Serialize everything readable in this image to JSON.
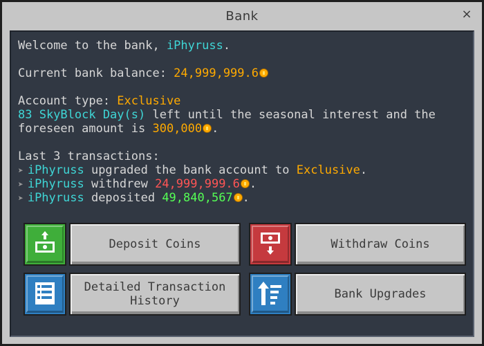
{
  "window": {
    "title": "Bank",
    "close_label": "×"
  },
  "welcome": {
    "prefix": "Welcome to the bank, ",
    "player": "iPhyruss",
    "suffix": "."
  },
  "balance": {
    "label": "Current bank balance: ",
    "value": "24,999,999.6"
  },
  "account": {
    "type_label": "Account type: ",
    "type_value": "Exclusive",
    "days": "83 SkyBlock Day(s)",
    "interest_text_1": " left until the seasonal interest and the",
    "interest_text_2": "foreseen amount is ",
    "interest_amount": "300,000",
    "interest_suffix": "."
  },
  "transactions": {
    "header": "Last 3 transactions:",
    "items": [
      {
        "player": "iPhyruss",
        "action": " upgraded the bank account to ",
        "value": "Exclusive",
        "suffix": ".",
        "coin": false
      },
      {
        "player": "iPhyruss",
        "action": " withdrew ",
        "value": "24,999,999.6",
        "suffix": ".",
        "coin": true
      },
      {
        "player": "iPhyruss",
        "action": " deposited ",
        "value": "49,840,567",
        "suffix": ".",
        "coin": true
      }
    ]
  },
  "buttons": {
    "deposit": "Deposit Coins",
    "withdraw": "Withdraw Coins",
    "history_line1": "Detailed Transaction",
    "history_line2": "History",
    "upgrades": "Bank Upgrades"
  },
  "icons": {
    "deposit": "deposit-icon",
    "withdraw": "withdraw-icon",
    "history": "list-icon",
    "upgrades": "upgrade-icon"
  },
  "colors": {
    "panel": "#313843",
    "player": "#3fd6d6",
    "gold": "#ffaa00",
    "withdraw_amount": "#ff5555",
    "deposit_amount": "#55ff55",
    "deposit_button": "#3fae3a",
    "withdraw_button": "#c53a3e",
    "info_button": "#2f7fc1"
  }
}
